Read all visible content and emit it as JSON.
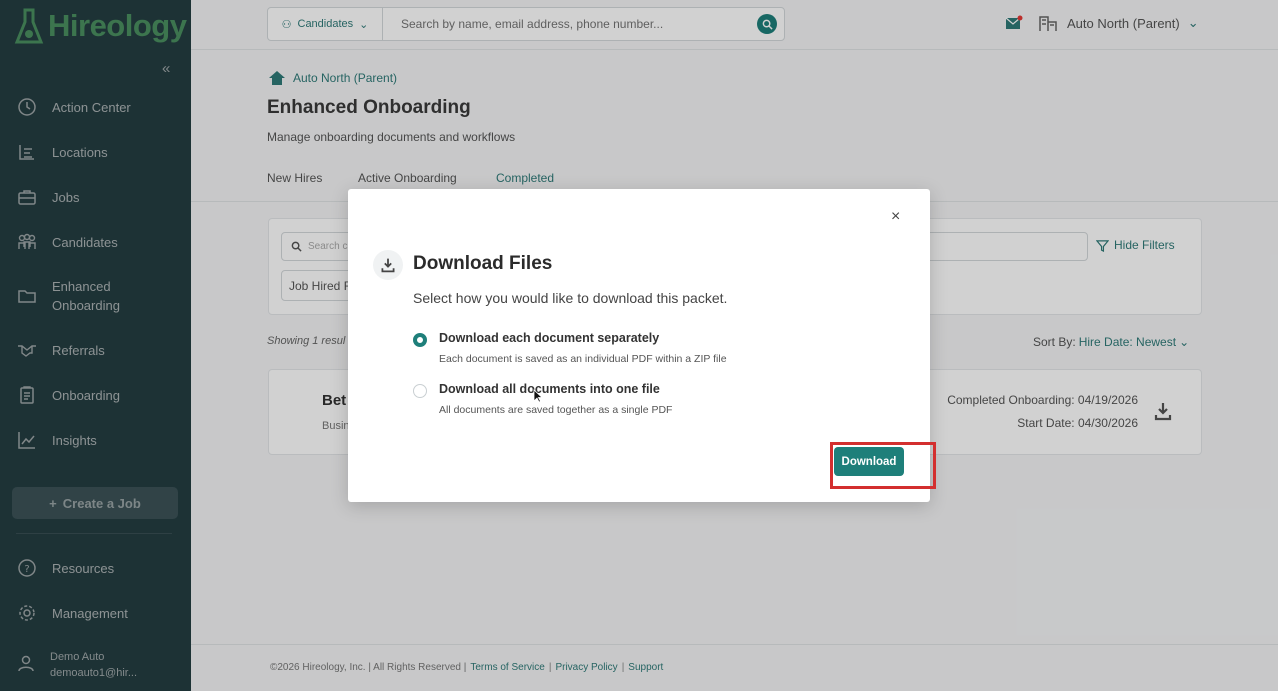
{
  "brand": {
    "name": "Hireology",
    "accent": "#1e7f7a",
    "sidebar_bg": "#2f4f55",
    "highlight": "#d32f2f"
  },
  "sidebar": {
    "items": [
      {
        "label": "Action Center",
        "icon": "clock-icon"
      },
      {
        "label": "Locations",
        "icon": "list-icon"
      },
      {
        "label": "Jobs",
        "icon": "briefcase-icon"
      },
      {
        "label": "Candidates",
        "icon": "people-icon"
      },
      {
        "label": "Enhanced",
        "label2": "Onboarding",
        "icon": "folder-icon"
      },
      {
        "label": "Referrals",
        "icon": "handshake-icon"
      },
      {
        "label": "Onboarding",
        "icon": "clipboard-icon"
      },
      {
        "label": "Insights",
        "icon": "chart-icon"
      }
    ],
    "create_job": "Create a Job",
    "resources": "Resources",
    "management": "Management",
    "user_name": "Demo Auto",
    "user_email": "demoauto1@hir..."
  },
  "topbar": {
    "scope": "Candidates",
    "search_placeholder": "Search by name, email address, phone number...",
    "org": "Auto North (Parent)"
  },
  "page": {
    "breadcrumb": "Auto North (Parent)",
    "title": "Enhanced Onboarding",
    "subtitle": "Manage onboarding documents and workflows",
    "tabs": [
      "New Hires",
      "Active Onboarding",
      "Completed"
    ]
  },
  "filters": {
    "search_placeholder": "Search c",
    "hide_filters": "Hide Filters",
    "chip": "Job Hired F"
  },
  "results": {
    "showing": "Showing 1 resul",
    "sort_label": "Sort By:",
    "sort_value": "Hire Date: Newest",
    "name": "Bet",
    "sub": "Busin",
    "completed": "Completed Onboarding: 04/19/2026",
    "start": "Start Date: 04/30/2026"
  },
  "footer": {
    "copyright": "©2026 Hireology, Inc. | All Rights Reserved |",
    "terms": "Terms of Service",
    "privacy": "Privacy Policy",
    "support": "Support"
  },
  "modal": {
    "title": "Download Files",
    "description": "Select how you would like to download this packet.",
    "options": [
      {
        "label": "Download each document separately",
        "help": "Each document is saved as an individual PDF within a ZIP file",
        "selected": true
      },
      {
        "label": "Download all documents into one file",
        "help": "All documents are saved together as a single PDF",
        "selected": false
      }
    ],
    "button": "Download",
    "close": "×"
  }
}
